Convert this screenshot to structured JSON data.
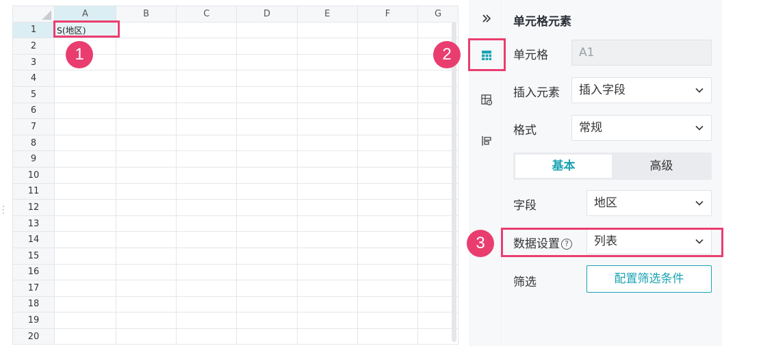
{
  "sheet": {
    "columns": [
      "A",
      "B",
      "C",
      "D",
      "E",
      "F",
      "G"
    ],
    "rows": [
      "1",
      "2",
      "3",
      "4",
      "5",
      "6",
      "7",
      "8",
      "9",
      "10",
      "11",
      "12",
      "13",
      "14",
      "15",
      "16",
      "17",
      "18",
      "19",
      "20"
    ],
    "cell_a1": "S(地区)"
  },
  "strip": {
    "icons": [
      "collapse-icon",
      "cell-element-icon",
      "cell-attribute-icon",
      "chart-attribute-icon"
    ]
  },
  "panel": {
    "title": "单元格元素",
    "cell": {
      "label": "单元格",
      "value": "A1"
    },
    "insert": {
      "label": "插入元素",
      "value": "插入字段"
    },
    "format": {
      "label": "格式",
      "value": "常规"
    },
    "tabs": {
      "basic": "基本",
      "advanced": "高级"
    },
    "field": {
      "label": "字段",
      "value": "地区"
    },
    "data_setting": {
      "label": "数据设置",
      "value": "列表"
    },
    "filter": {
      "label": "筛选",
      "button": "配置筛选条件"
    }
  },
  "annotations": {
    "badge1": "1",
    "badge2": "2",
    "badge3": "3",
    "color": "#ea3d6f"
  },
  "colors": {
    "accent": "#1ba3b3",
    "highlight": "#ea3d6f"
  }
}
